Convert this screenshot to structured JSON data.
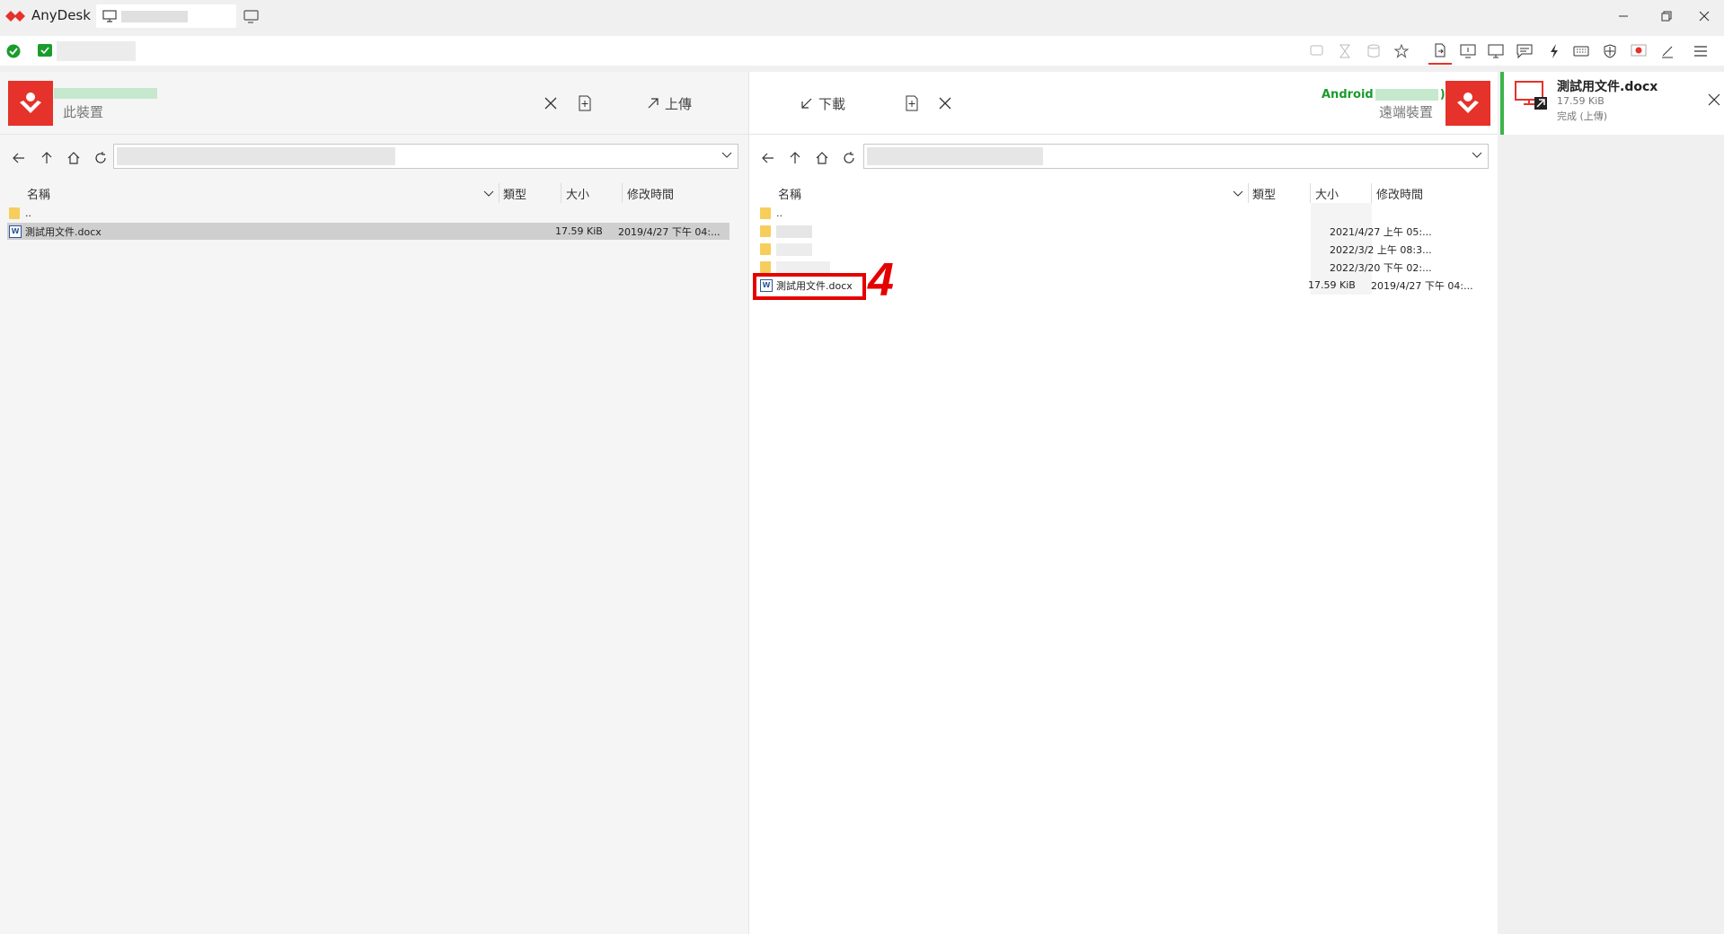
{
  "app": {
    "title": "AnyDesk"
  },
  "local": {
    "device_label": "此裝置",
    "close_label": "",
    "upload_label": "上傳",
    "columns": [
      "名稱",
      "類型",
      "大小",
      "修改時間"
    ],
    "files": [
      {
        "name": "..",
        "type": "folder",
        "size": "",
        "modified": ""
      },
      {
        "name": "測試用文件.docx",
        "type": "doc",
        "size": "17.59 KiB",
        "modified": "2019/4/27 下午 04:..."
      }
    ]
  },
  "remote": {
    "device_name_prefix": "Android",
    "device_name_suffix": ")",
    "device_label": "遠端裝置",
    "download_label": "下載",
    "columns": [
      "名稱",
      "類型",
      "大小",
      "修改時間"
    ],
    "files": [
      {
        "name": "..",
        "type": "folder",
        "size": "",
        "modified": ""
      },
      {
        "name": "",
        "type": "folder",
        "size": "",
        "modified": "2021/4/27 上午 05:..."
      },
      {
        "name": "",
        "type": "folder",
        "size": "",
        "modified": "2022/3/2 上午 08:3..."
      },
      {
        "name": "",
        "type": "folder",
        "size": "",
        "modified": "2022/3/20 下午 02:..."
      },
      {
        "name": "測試用文件.docx",
        "type": "doc",
        "size": "17.59 KiB",
        "modified": "2019/4/27 下午 04:..."
      }
    ]
  },
  "annotation": {
    "step_number": "4",
    "color": "#e50000"
  },
  "transfer": {
    "filename": "測試用文件.docx",
    "size": "17.59 KiB",
    "status": "完成 (上傳)"
  },
  "colors": {
    "brand_red": "#e5322a",
    "green": "#1a9c2c",
    "selection": "#cfcfcf"
  }
}
